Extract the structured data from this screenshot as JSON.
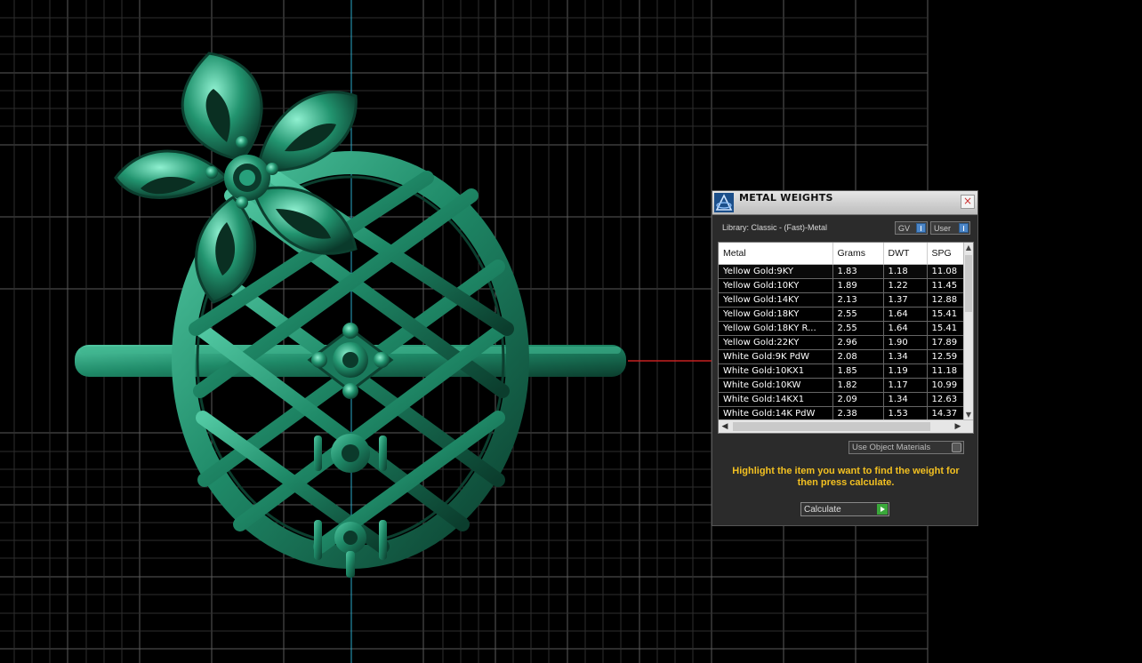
{
  "panel": {
    "title": "METAL WEIGHTS",
    "library_label": "Library: Classic - (Fast)-Metal",
    "toggle_gv": "GV",
    "toggle_user": "User",
    "columns": [
      "Metal",
      "Grams",
      "DWT",
      "SPG"
    ],
    "rows": [
      [
        "Yellow Gold:9KY",
        "1.83",
        "1.18",
        "11.08"
      ],
      [
        "Yellow Gold:10KY",
        "1.89",
        "1.22",
        "11.45"
      ],
      [
        "Yellow Gold:14KY",
        "2.13",
        "1.37",
        "12.88"
      ],
      [
        "Yellow Gold:18KY",
        "2.55",
        "1.64",
        "15.41"
      ],
      [
        "Yellow Gold:18KY R...",
        "2.55",
        "1.64",
        "15.41"
      ],
      [
        "Yellow Gold:22KY",
        "2.96",
        "1.90",
        "17.89"
      ],
      [
        "White Gold:9K PdW",
        "2.08",
        "1.34",
        "12.59"
      ],
      [
        "White Gold:10KX1",
        "1.85",
        "1.19",
        "11.18"
      ],
      [
        "White Gold:10KW",
        "1.82",
        "1.17",
        "10.99"
      ],
      [
        "White Gold:14KX1",
        "2.09",
        "1.34",
        "12.63"
      ],
      [
        "White Gold:14K PdW",
        "2.38",
        "1.53",
        "14.37"
      ]
    ],
    "use_object_materials": "Use Object Materials",
    "hint": "Highlight the item you want to find the weight for then press calculate.",
    "calculate_label": "Calculate"
  },
  "colors": {
    "model": "#1f8a68",
    "grid": "#5a5a5a",
    "axis_vertical": "#2aa9c8",
    "axis_horizontal": "#c62020",
    "hint": "#f2c021"
  }
}
